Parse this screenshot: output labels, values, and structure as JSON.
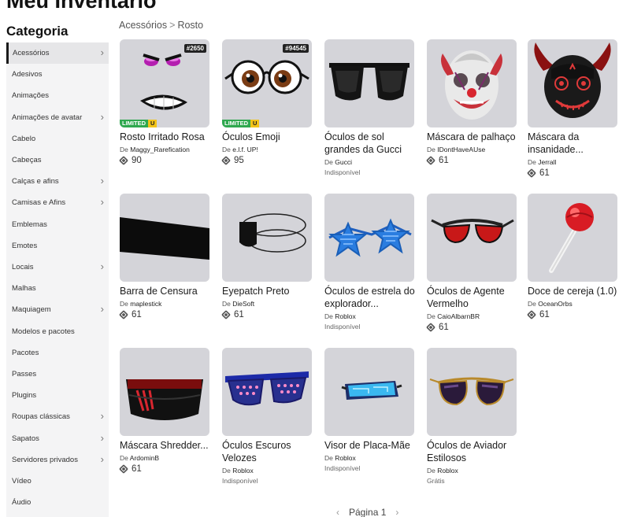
{
  "header": {
    "title": "Meu Inventário",
    "category_title": "Categoria"
  },
  "breadcrumb": {
    "parent": "Acessórios",
    "separator": ">",
    "current": "Rosto"
  },
  "sidebar": {
    "items": [
      {
        "label": "Acessórios",
        "chevron": true,
        "active": true
      },
      {
        "label": "Adesivos",
        "chevron": false
      },
      {
        "label": "Animações",
        "chevron": false
      },
      {
        "label": "Animações de avatar",
        "chevron": true
      },
      {
        "label": "Cabelo",
        "chevron": false
      },
      {
        "label": "Cabeças",
        "chevron": false
      },
      {
        "label": "Calças e afins",
        "chevron": true
      },
      {
        "label": "Camisas e Afins",
        "chevron": true
      },
      {
        "label": "Emblemas",
        "chevron": false
      },
      {
        "label": "Emotes",
        "chevron": false
      },
      {
        "label": "Locais",
        "chevron": true
      },
      {
        "label": "Malhas",
        "chevron": false
      },
      {
        "label": "Maquiagem",
        "chevron": true
      },
      {
        "label": "Modelos e pacotes",
        "chevron": false
      },
      {
        "label": "Pacotes",
        "chevron": false
      },
      {
        "label": "Passes",
        "chevron": false
      },
      {
        "label": "Plugins",
        "chevron": false
      },
      {
        "label": "Roupas clássicas",
        "chevron": true
      },
      {
        "label": "Sapatos",
        "chevron": true
      },
      {
        "label": "Servidores privados",
        "chevron": true
      },
      {
        "label": "Vídeo",
        "chevron": false
      },
      {
        "label": "Áudio",
        "chevron": false
      }
    ],
    "chevron_glyph": "›"
  },
  "items": [
    {
      "name": "Rosto Irritado Rosa",
      "creator_prefix": "De",
      "creator": "Maggy_Rarefication",
      "price": "90",
      "serial": "#2650",
      "limited": "LIMITED",
      "limited_u": "U",
      "icon": "angry-pink-face-icon"
    },
    {
      "name": "Óculos Emoji",
      "creator_prefix": "De",
      "creator": "e.l.f. UP!",
      "price": "95",
      "serial": "#94545",
      "limited": "LIMITED",
      "limited_u": "U",
      "icon": "emoji-glasses-icon"
    },
    {
      "name": "Óculos de sol grandes da Gucci",
      "creator_prefix": "De",
      "creator": "Gucci",
      "status": "Indisponível",
      "icon": "gucci-sunglasses-icon"
    },
    {
      "name": "Máscara de palhaço",
      "creator_prefix": "De",
      "creator": "IDontHaveAUse",
      "price": "61",
      "icon": "clown-mask-icon"
    },
    {
      "name": "Máscara da insanidade...",
      "creator_prefix": "De",
      "creator": "Jerrall",
      "price": "61",
      "icon": "insanity-mask-icon"
    },
    {
      "name": "Barra de Censura",
      "creator_prefix": "De",
      "creator": "maplestick",
      "price": "61",
      "icon": "censor-bar-icon"
    },
    {
      "name": "Eyepatch Preto",
      "creator_prefix": "De",
      "creator": "DieSoft",
      "price": "61",
      "icon": "eyepatch-icon"
    },
    {
      "name": "Óculos de estrela do explorador...",
      "creator_prefix": "De",
      "creator": "Roblox",
      "status": "Indisponível",
      "icon": "star-glasses-icon"
    },
    {
      "name": "Óculos de Agente Vermelho",
      "creator_prefix": "De",
      "creator": "CaioAlbarnBR",
      "price": "61",
      "icon": "red-agent-glasses-icon"
    },
    {
      "name": "Doce de cereja (1.0)",
      "creator_prefix": "De",
      "creator": "OceanOrbs",
      "price": "61",
      "icon": "cherry-lollipop-icon"
    },
    {
      "name": "Máscara Shredder...",
      "creator_prefix": "De",
      "creator": "ArdominB",
      "price": "61",
      "icon": "shredder-mask-icon"
    },
    {
      "name": "Óculos Escuros Velozes",
      "creator_prefix": "De",
      "creator": "Roblox",
      "status": "Indisponível",
      "icon": "fast-shades-icon"
    },
    {
      "name": "Visor de Placa-Mãe",
      "creator_prefix": "De",
      "creator": "Roblox",
      "status": "Indisponível",
      "icon": "motherboard-visor-icon"
    },
    {
      "name": "Óculos de Aviador Estilosos",
      "creator_prefix": "De",
      "creator": "Roblox",
      "status": "Grátis",
      "icon": "aviator-glasses-icon"
    }
  ],
  "pagination": {
    "prev": "‹",
    "label": "Página 1",
    "next": "›"
  },
  "colors": {
    "tile_bg": "#d4d4d9",
    "limited_green": "#2fa84f",
    "limited_yellow": "#f2c318",
    "sidebar_bg": "#f4f4f5"
  }
}
